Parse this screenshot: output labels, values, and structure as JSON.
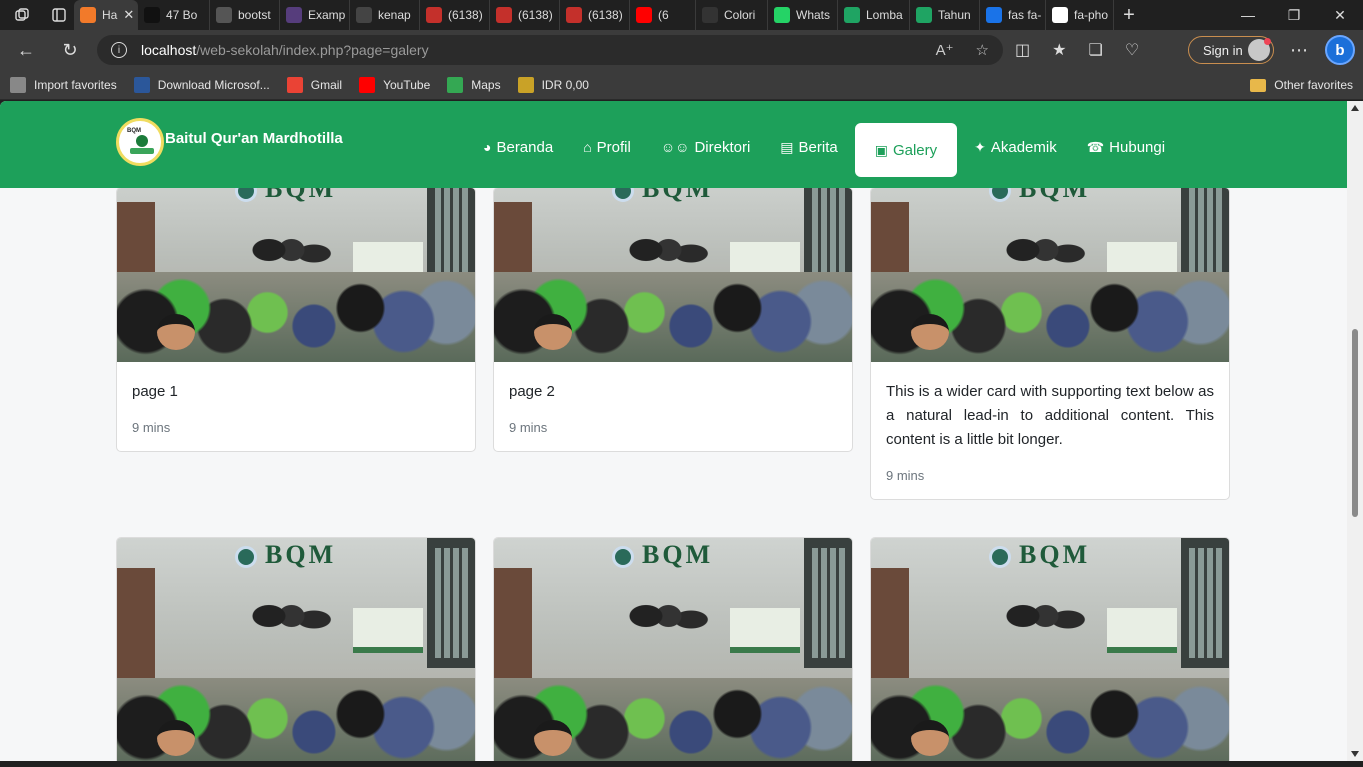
{
  "browser": {
    "tabs": [
      {
        "label": "Ha",
        "icon": "xampp-icon",
        "color": "#f27a2a",
        "active": true
      },
      {
        "label": "47 Bo",
        "icon": "f-icon",
        "color": "#111111",
        "active": false
      },
      {
        "label": "bootst",
        "icon": "codepen-icon",
        "color": "#555555",
        "active": false
      },
      {
        "label": "Examp",
        "icon": "bootstrap-icon",
        "color": "#563d7c",
        "active": false
      },
      {
        "label": "kenap",
        "icon": "user-icon",
        "color": "#444444",
        "active": false
      },
      {
        "label": "(6138)",
        "icon": "youtube-icon",
        "color": "#c4302b",
        "active": false
      },
      {
        "label": "(6138)",
        "icon": "youtube-icon",
        "color": "#c4302b",
        "active": false
      },
      {
        "label": "(6138)",
        "icon": "youtube-icon",
        "color": "#c4302b",
        "active": false
      },
      {
        "label": "(6",
        "icon": "youtube-icon",
        "color": "#ff0000",
        "active": false
      },
      {
        "label": "Colori",
        "icon": "dots-icon",
        "color": "#333333",
        "active": false
      },
      {
        "label": "Whats",
        "icon": "whatsapp-icon",
        "color": "#25d366",
        "active": false
      },
      {
        "label": "Lomba",
        "icon": "drive-icon",
        "color": "#1fa463",
        "active": false
      },
      {
        "label": "Tahun",
        "icon": "drive-icon",
        "color": "#1fa463",
        "active": false
      },
      {
        "label": "fas fa-",
        "icon": "search-icon",
        "color": "#1a73e8",
        "active": false
      },
      {
        "label": "fa-pho",
        "icon": "flag-icon",
        "color": "#ffffff",
        "active": false
      }
    ],
    "url_host": "localhost",
    "url_path": "/web-sekolah/index.php?page=galery",
    "signin_label": "Sign in",
    "favorites": [
      {
        "label": "Import favorites",
        "icon": "import-icon",
        "color": "#888888"
      },
      {
        "label": "Download Microsof...",
        "icon": "word-icon",
        "color": "#2b579a"
      },
      {
        "label": "Gmail",
        "icon": "gmail-icon",
        "color": "#ea4335"
      },
      {
        "label": "YouTube",
        "icon": "youtube-icon",
        "color": "#ff0000"
      },
      {
        "label": "Maps",
        "icon": "maps-icon",
        "color": "#34a853"
      },
      {
        "label": "IDR 0,00",
        "icon": "coins-icon",
        "color": "#c9a227"
      }
    ],
    "other_favorites": "Other favorites"
  },
  "site": {
    "brand": "Baitul Qur'an Mardhotilla",
    "logo_text": "BQM",
    "menu": [
      {
        "label": "Beranda",
        "icon": "palette-icon",
        "active": false
      },
      {
        "label": "Profil",
        "icon": "home-icon",
        "active": false
      },
      {
        "label": "Direktori",
        "icon": "users-icon",
        "active": false
      },
      {
        "label": "Berita",
        "icon": "newspaper-icon",
        "active": false
      },
      {
        "label": "Galery",
        "icon": "image-icon",
        "active": true
      },
      {
        "label": "Akademik",
        "icon": "puzzle-icon",
        "active": false
      },
      {
        "label": "Hubungi",
        "icon": "phone-icon",
        "active": false
      }
    ],
    "brand_color": "#1da05a"
  },
  "gallery": {
    "sign_text": "BQM",
    "cards": [
      {
        "title": "page 1",
        "time": "9 mins"
      },
      {
        "title": "page 2",
        "time": "9 mins"
      },
      {
        "title": "This is a wider card with supporting text below as a natural lead-in to additional content. This content is a little bit longer.",
        "time": "9 mins"
      },
      {
        "title": "",
        "time": ""
      },
      {
        "title": "",
        "time": ""
      },
      {
        "title": "",
        "time": ""
      }
    ]
  }
}
